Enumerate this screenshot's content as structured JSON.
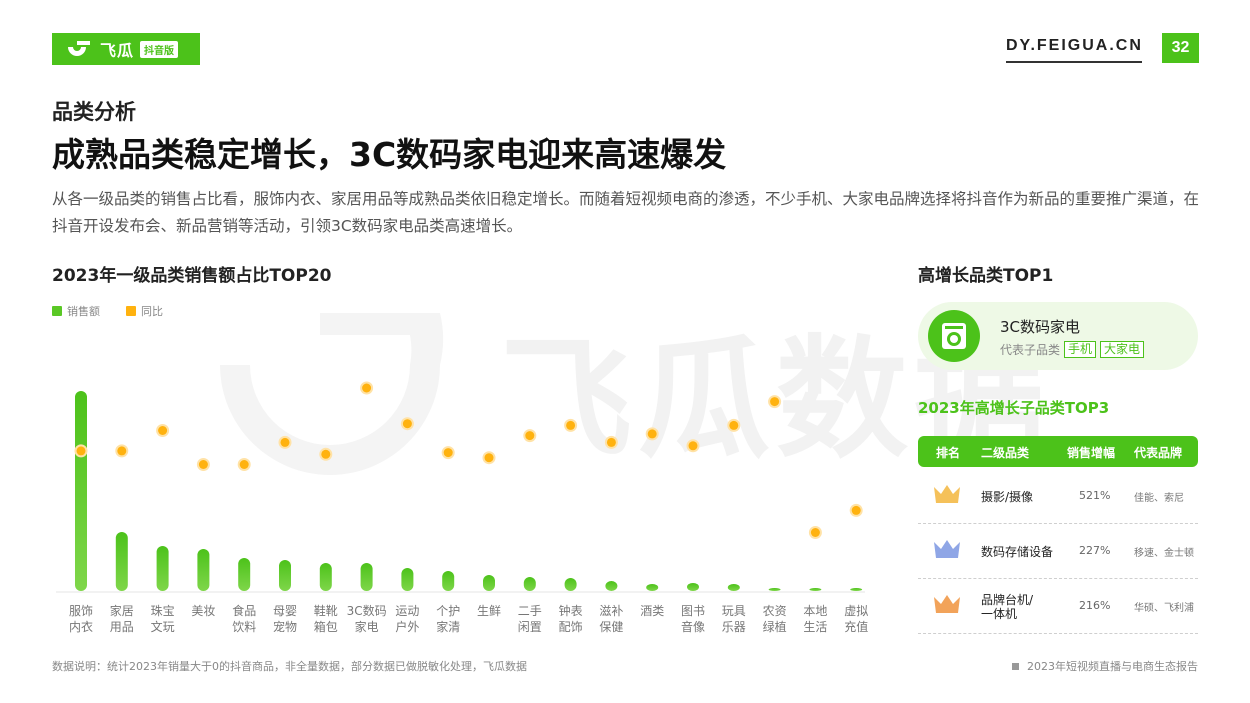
{
  "header": {
    "brand": "飞瓜",
    "brand_sub": "抖音版",
    "site": "DY.FEIGUA.CN",
    "page_number": "32"
  },
  "section_label": "品类分析",
  "headline": "成熟品类稳定增长，3C数码家电迎来高速爆发",
  "description": "从各一级品类的销售占比看，服饰内衣、家居用品等成熟品类依旧稳定增长。而随着短视频电商的渗透，不少手机、大家电品牌选择将抖音作为新品的重要推广渠道，在抖音开设发布会、新品营销等活动，引领3C数码家电品类高速增长。",
  "watermark_text": "飞瓜数据",
  "colors": {
    "accent": "#4cc21a",
    "bar": "#5ac825",
    "dot": "#ffb20f"
  },
  "chart_data": {
    "type": "bar",
    "title": "2023年一级品类销售额占比TOP20",
    "legend_position": "top-left",
    "categories": [
      [
        "服饰",
        "内衣"
      ],
      [
        "家居",
        "用品"
      ],
      [
        "珠宝",
        "文玩"
      ],
      [
        "美妆",
        ""
      ],
      [
        "食品",
        "饮料"
      ],
      [
        "母婴",
        "宠物"
      ],
      [
        "鞋靴",
        "箱包"
      ],
      [
        "3C数码",
        "家电"
      ],
      [
        "运动",
        "户外"
      ],
      [
        "个护",
        "家清"
      ],
      [
        "生鲜",
        ""
      ],
      [
        "二手",
        "闲置"
      ],
      [
        "钟表",
        "配饰"
      ],
      [
        "滋补",
        "保健"
      ],
      [
        "酒类",
        ""
      ],
      [
        "图书",
        "音像"
      ],
      [
        "玩具",
        "乐器"
      ],
      [
        "农资",
        "绿植"
      ],
      [
        "本地",
        "生活"
      ],
      [
        "虚拟",
        "充值"
      ]
    ],
    "series": [
      {
        "name": "销售额",
        "color": "#5ac825",
        "values": [
          100,
          29.5,
          22.5,
          21,
          16.5,
          15.5,
          14,
          14,
          11.5,
          10,
          8,
          7,
          6.5,
          5,
          3.5,
          4,
          3.5,
          1.5,
          1.5,
          1.5
        ]
      },
      {
        "name": "同比",
        "color": "#ffb20f",
        "values": [
          63,
          63,
          75,
          55,
          55,
          68,
          61,
          100,
          79,
          62,
          59,
          72,
          78,
          68,
          73,
          66,
          78,
          92,
          15,
          28
        ]
      }
    ],
    "grid": false
  },
  "top1": {
    "title": "高增长品类TOP1",
    "name": "3C数码家电",
    "rep_label": "代表子品类",
    "tags": [
      "手机",
      "大家电"
    ]
  },
  "top3": {
    "title": "2023年高增长子品类TOP3",
    "headers": [
      "排名",
      "二级品类",
      "销售增幅",
      "代表品牌"
    ],
    "rows": [
      {
        "category": "摄影/摄像",
        "growth": "521%",
        "brands": "佳能、索尼",
        "crown_color": "#f5c15a"
      },
      {
        "category": "数码存储设备",
        "growth": "227%",
        "brands": "移速、金士顿",
        "crown_color": "#8fa6e6"
      },
      {
        "category": "品牌台机/\n一体机",
        "growth": "216%",
        "brands": "华硕、飞利浦",
        "crown_color": "#f2a35a"
      }
    ]
  },
  "footnote": "数据说明：统计2023年销量大于0的抖音商品，非全量数据，部分数据已做脱敏化处理，飞瓜数据",
  "report_title": "2023年短视频直播与电商生态报告"
}
